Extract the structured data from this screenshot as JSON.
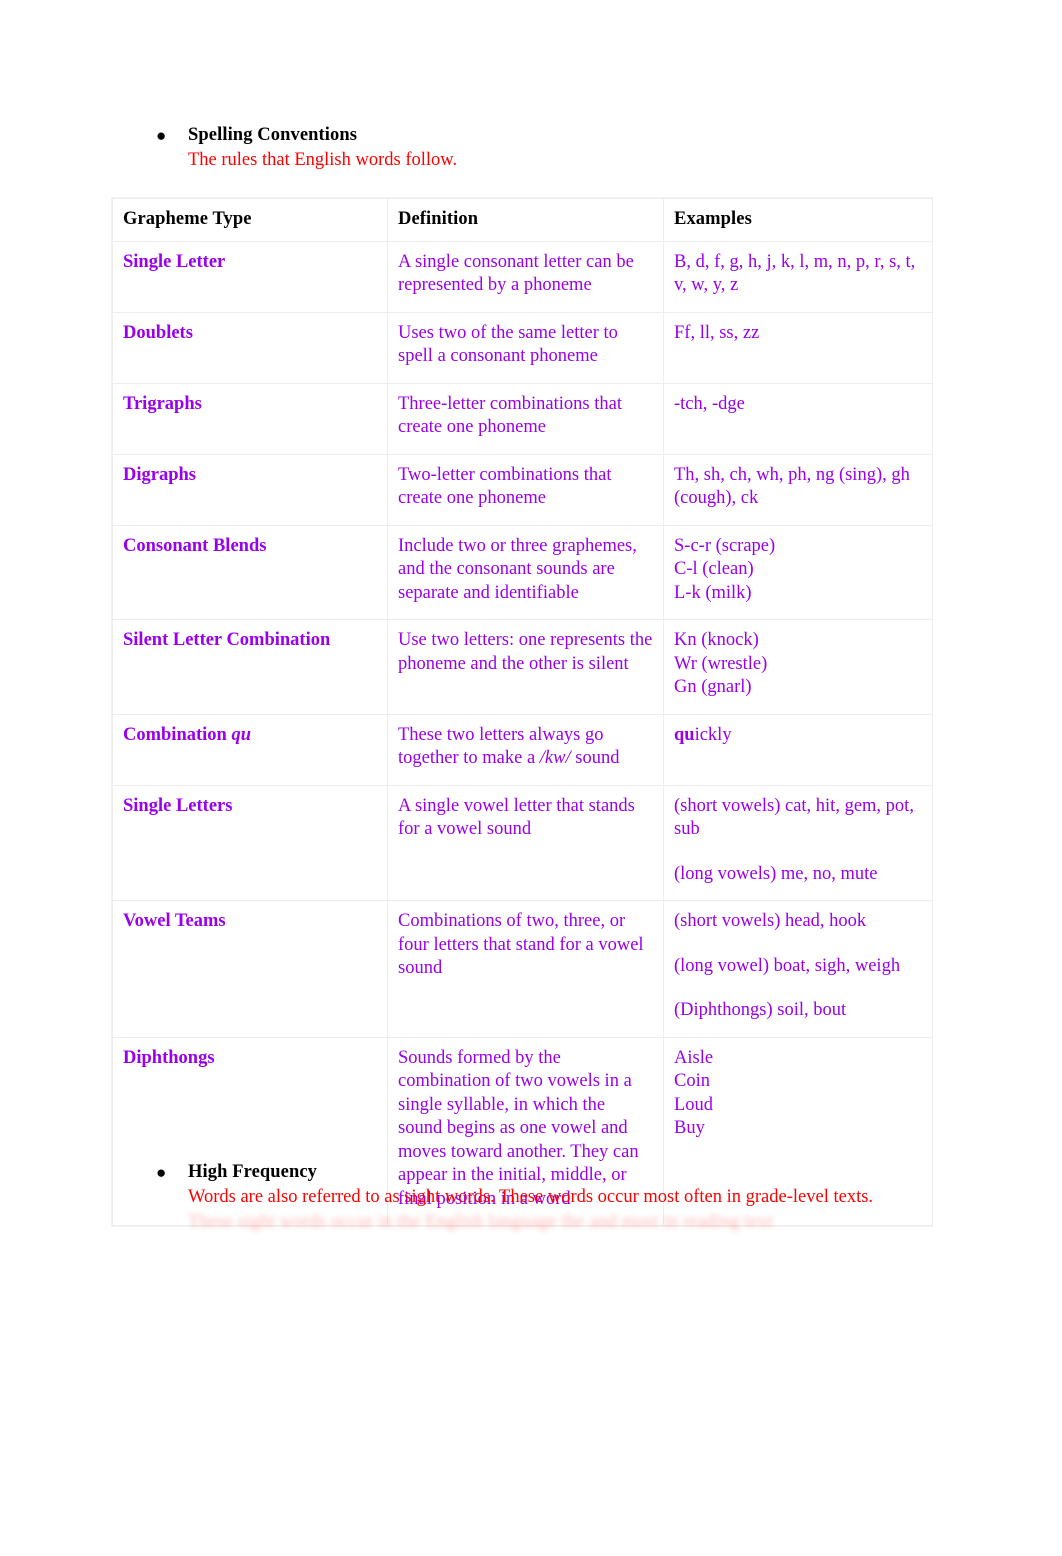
{
  "sections": {
    "spelling": {
      "bullet": "●",
      "title": "Spelling Conventions",
      "subtitle": "The rules that English words follow."
    },
    "high_frequency": {
      "bullet": "●",
      "title": "High Frequency",
      "subtitle": "Words are also referred to as sight words. These words occur most often in grade-level texts.",
      "faded_line": "These sight words occur in the English language the and most in reading text"
    }
  },
  "table": {
    "headers": [
      "Grapheme Type",
      "Definition",
      "Examples"
    ],
    "rows": [
      {
        "term": "Single Letter",
        "definition": "A single consonant letter can be represented by a phoneme",
        "examples": [
          "B, d, f, g, h, j, k, l, m, n, p, r, s, t, v, w, y, z"
        ]
      },
      {
        "term": "Doublets",
        "definition": "Uses two of the same letter to spell a consonant phoneme",
        "examples": [
          "Ff, ll, ss, zz"
        ]
      },
      {
        "term": "Trigraphs",
        "definition": "Three-letter combinations that create one phoneme",
        "examples": [
          "-tch, -dge"
        ]
      },
      {
        "term": "Digraphs",
        "definition": "Two-letter combinations that create one phoneme",
        "examples": [
          "Th, sh, ch, wh, ph, ng (sing), gh (cough), ck"
        ]
      },
      {
        "term": "Consonant Blends",
        "definition": "Include two or three graphemes, and the consonant sounds are separate and identifiable",
        "examples": [
          "S-c-r (scrape)",
          "C-l (clean)",
          "L-k (milk)"
        ]
      },
      {
        "term": "Silent Letter Combination",
        "definition": "Use two letters: one represents the phoneme and the other is silent",
        "examples": [
          "Kn (knock)",
          "Wr (wrestle)",
          "Gn (gnarl)"
        ]
      },
      {
        "term": "Combination qu",
        "term_italic_part": "qu",
        "definition": "These two letters always go together to make a /kw/ sound",
        "definition_italic_part": "/kw/",
        "examples": [
          "quickly"
        ],
        "examples_bold_part": "qu"
      },
      {
        "term": "Single Letters",
        "definition": "A single vowel letter that stands for a vowel sound",
        "examples": [
          "(short vowels) cat, hit, gem, pot, sub",
          "(long vowels) me, no, mute"
        ],
        "examples_spaced": true
      },
      {
        "term": "Vowel Teams",
        "definition": "Combinations of two, three, or four letters that stand for a vowel sound",
        "examples": [
          "(short vowels) head, hook",
          "(long vowel) boat, sigh, weigh",
          "(Diphthongs) soil, bout"
        ],
        "examples_spaced": true
      },
      {
        "term": "Diphthongs",
        "definition": "Sounds formed by the combination of two vowels in a single syllable, in which the sound begins as one vowel and moves toward another. They can appear in the initial, middle, or final position in a word",
        "examples": [
          "Aisle",
          "Coin",
          "Loud",
          "Buy"
        ]
      }
    ]
  },
  "colors": {
    "term": "#9900ee",
    "annotation": "#ff0000",
    "header": "#000000",
    "border": "#ededed"
  }
}
